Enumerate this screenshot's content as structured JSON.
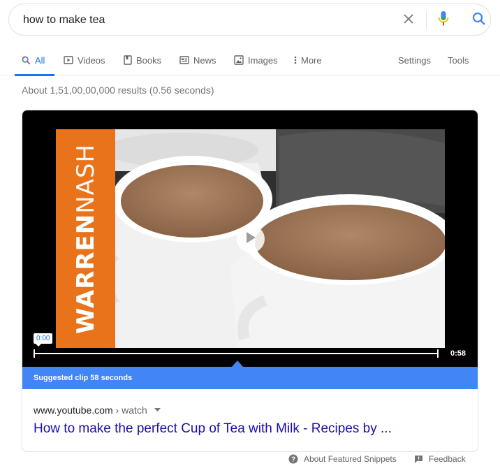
{
  "search": {
    "query": "how to make tea"
  },
  "icons": {
    "clear": "close-icon",
    "mic": "mic-icon",
    "search": "search-icon",
    "play": "play-icon"
  },
  "tabs": [
    {
      "label": "All",
      "icon": "search-icon",
      "active": true
    },
    {
      "label": "Videos",
      "icon": "video-icon"
    },
    {
      "label": "Books",
      "icon": "book-icon"
    },
    {
      "label": "News",
      "icon": "news-icon"
    },
    {
      "label": "Images",
      "icon": "image-icon"
    },
    {
      "label": "More",
      "icon": "more-vert-icon"
    }
  ],
  "tools": {
    "settings": "Settings",
    "tools": "Tools"
  },
  "stats": "About 1,51,00,00,000 results (0.56 seconds)",
  "video": {
    "brand_bold": "WARREN",
    "brand_light": "NASH",
    "time_current": "0:00",
    "time_total": "0:58",
    "progress": 0
  },
  "suggested_clip": "Suggested clip 58 seconds",
  "result": {
    "domain": "www.youtube.com",
    "path": "› watch",
    "title": "How to make the perfect Cup of Tea with Milk - Recipes by ..."
  },
  "footer": {
    "about": "About Featured Snippets",
    "feedback": "Feedback"
  },
  "colors": {
    "accent": "#1a73e8",
    "link": "#1a0dab",
    "clip_bar": "#4285f4",
    "brand_orange": "#e8731a"
  }
}
